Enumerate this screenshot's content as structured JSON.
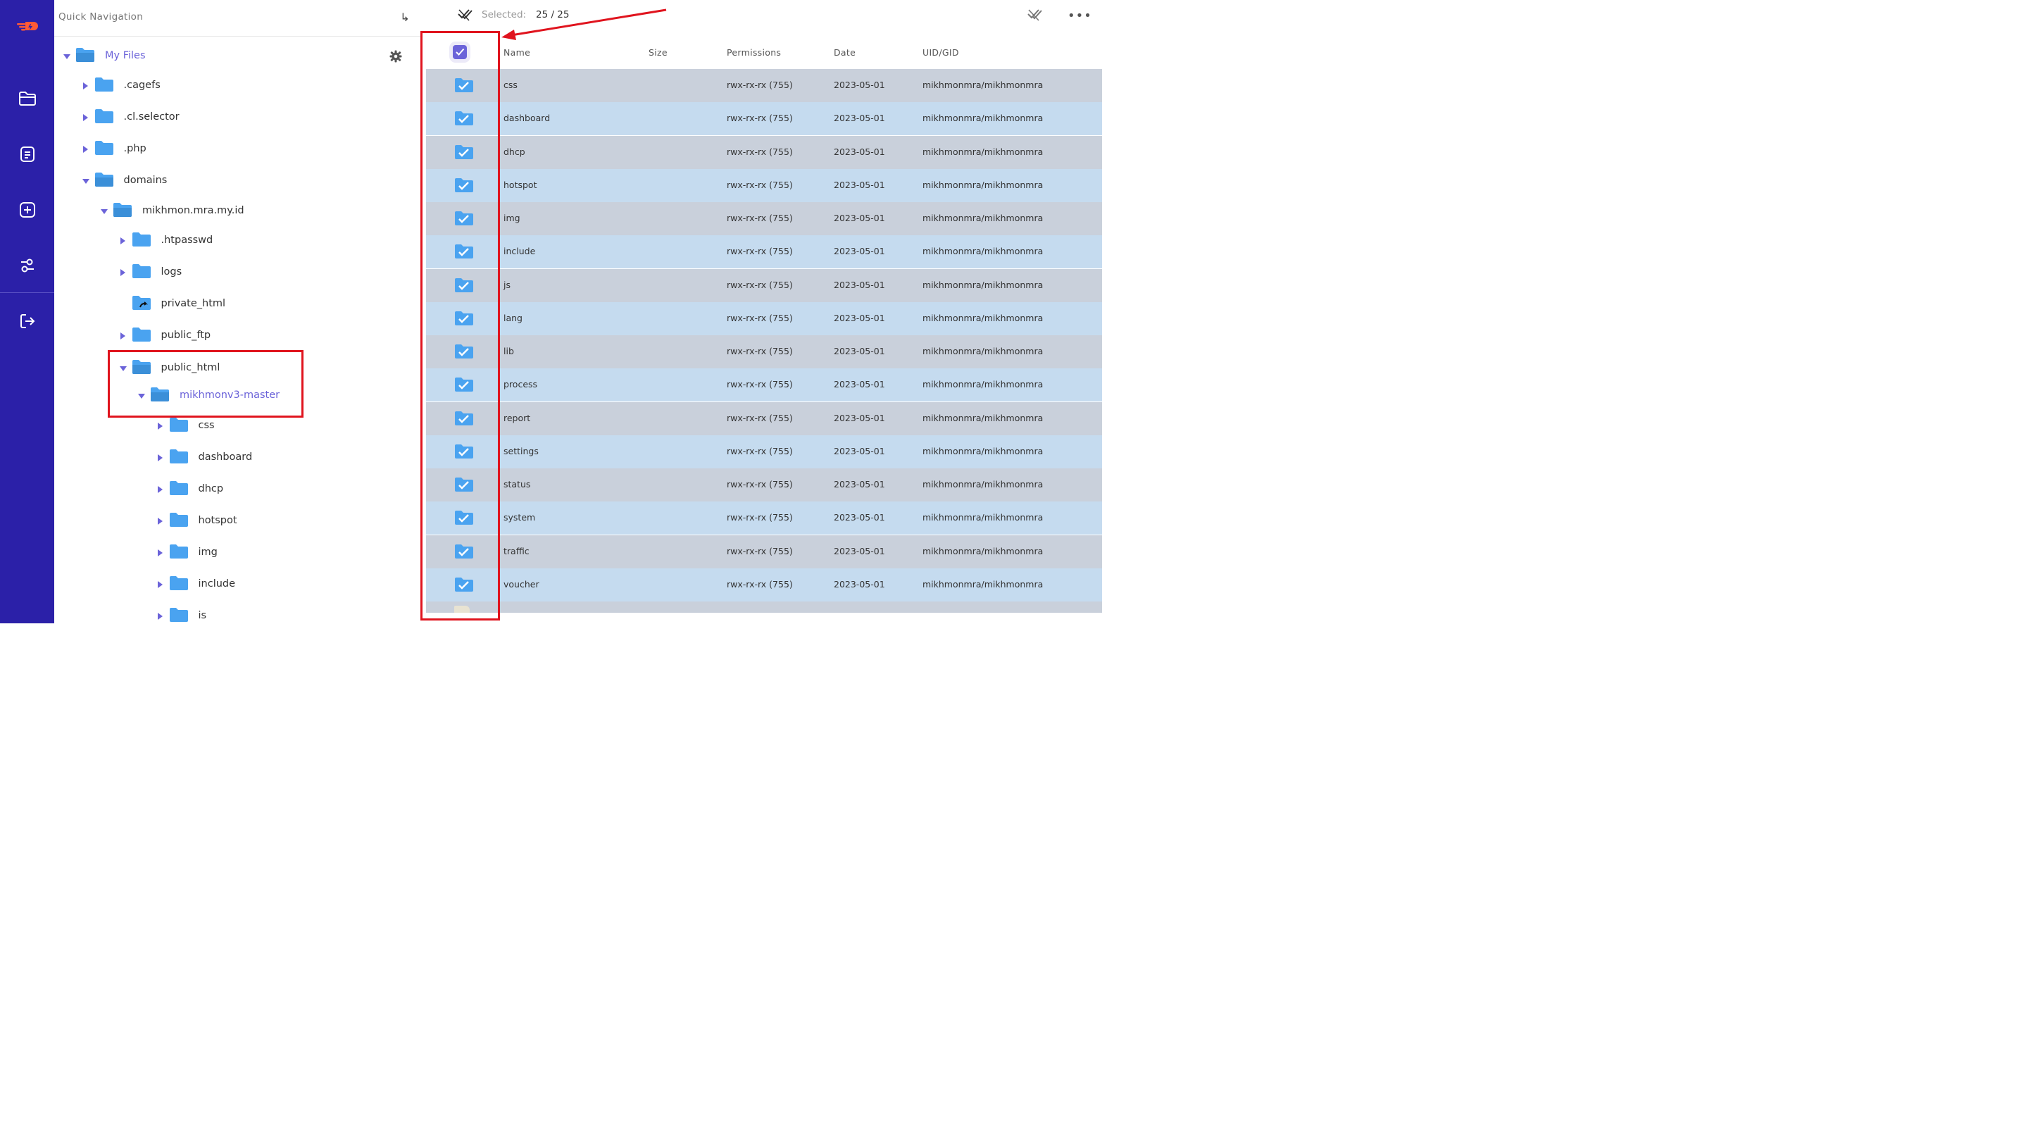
{
  "rail": {
    "items": [
      {
        "name": "app-logo-icon"
      },
      {
        "name": "folder-icon"
      },
      {
        "name": "document-icon"
      },
      {
        "name": "add-icon"
      },
      {
        "name": "sliders-icon"
      },
      {
        "name": "logout-icon"
      }
    ],
    "colors": {
      "background": "#2b20a8",
      "logo": "#ff5a36"
    }
  },
  "tree": {
    "header_label": "Quick Navigation",
    "items": [
      {
        "label": "My Files",
        "level": 0,
        "expanded": true,
        "accent": true,
        "has_children": true
      },
      {
        "label": ".cagefs",
        "level": 1,
        "expanded": false,
        "has_children": true
      },
      {
        "label": ".cl.selector",
        "level": 1,
        "expanded": false,
        "has_children": true
      },
      {
        "label": ".php",
        "level": 1,
        "expanded": false,
        "has_children": true
      },
      {
        "label": "domains",
        "level": 1,
        "expanded": true,
        "has_children": true
      },
      {
        "label": "mikhmon.mra.my.id",
        "level": 2,
        "expanded": true,
        "has_children": true
      },
      {
        "label": ".htpasswd",
        "level": 3,
        "expanded": false,
        "has_children": true
      },
      {
        "label": "logs",
        "level": 3,
        "expanded": false,
        "has_children": true
      },
      {
        "label": "private_html",
        "level": 3,
        "expanded": false,
        "has_children": false,
        "symlink": true
      },
      {
        "label": "public_ftp",
        "level": 3,
        "expanded": false,
        "has_children": true
      },
      {
        "label": "public_html",
        "level": 3,
        "expanded": true,
        "has_children": true
      },
      {
        "label": "mikhmonv3-master",
        "level": 4,
        "expanded": true,
        "accent": true,
        "has_children": true
      },
      {
        "label": "css",
        "level": 5,
        "expanded": false,
        "has_children": true
      },
      {
        "label": "dashboard",
        "level": 5,
        "expanded": false,
        "has_children": true
      },
      {
        "label": "dhcp",
        "level": 5,
        "expanded": false,
        "has_children": true
      },
      {
        "label": "hotspot",
        "level": 5,
        "expanded": false,
        "has_children": true
      },
      {
        "label": "img",
        "level": 5,
        "expanded": false,
        "has_children": true
      },
      {
        "label": "include",
        "level": 5,
        "expanded": false,
        "has_children": true
      },
      {
        "label": "is",
        "level": 5,
        "expanded": false,
        "has_children": true
      }
    ]
  },
  "toolbar": {
    "selected_label": "Selected:",
    "selected_count": "25 / 25"
  },
  "table": {
    "columns": [
      "Name",
      "Size",
      "Permissions",
      "Date",
      "UID/GID"
    ],
    "select_all_checked": true,
    "rows": [
      {
        "name": "css",
        "size": "",
        "permissions": "rwx-rx-rx (755)",
        "date": "2023-05-01",
        "owner": "mikhmonmra/mikhmonmra"
      },
      {
        "name": "dashboard",
        "size": "",
        "permissions": "rwx-rx-rx (755)",
        "date": "2023-05-01",
        "owner": "mikhmonmra/mikhmonmra"
      },
      {
        "name": "dhcp",
        "size": "",
        "permissions": "rwx-rx-rx (755)",
        "date": "2023-05-01",
        "owner": "mikhmonmra/mikhmonmra"
      },
      {
        "name": "hotspot",
        "size": "",
        "permissions": "rwx-rx-rx (755)",
        "date": "2023-05-01",
        "owner": "mikhmonmra/mikhmonmra"
      },
      {
        "name": "img",
        "size": "",
        "permissions": "rwx-rx-rx (755)",
        "date": "2023-05-01",
        "owner": "mikhmonmra/mikhmonmra"
      },
      {
        "name": "include",
        "size": "",
        "permissions": "rwx-rx-rx (755)",
        "date": "2023-05-01",
        "owner": "mikhmonmra/mikhmonmra"
      },
      {
        "name": "js",
        "size": "",
        "permissions": "rwx-rx-rx (755)",
        "date": "2023-05-01",
        "owner": "mikhmonmra/mikhmonmra"
      },
      {
        "name": "lang",
        "size": "",
        "permissions": "rwx-rx-rx (755)",
        "date": "2023-05-01",
        "owner": "mikhmonmra/mikhmonmra"
      },
      {
        "name": "lib",
        "size": "",
        "permissions": "rwx-rx-rx (755)",
        "date": "2023-05-01",
        "owner": "mikhmonmra/mikhmonmra"
      },
      {
        "name": "process",
        "size": "",
        "permissions": "rwx-rx-rx (755)",
        "date": "2023-05-01",
        "owner": "mikhmonmra/mikhmonmra"
      },
      {
        "name": "report",
        "size": "",
        "permissions": "rwx-rx-rx (755)",
        "date": "2023-05-01",
        "owner": "mikhmonmra/mikhmonmra"
      },
      {
        "name": "settings",
        "size": "",
        "permissions": "rwx-rx-rx (755)",
        "date": "2023-05-01",
        "owner": "mikhmonmra/mikhmonmra"
      },
      {
        "name": "status",
        "size": "",
        "permissions": "rwx-rx-rx (755)",
        "date": "2023-05-01",
        "owner": "mikhmonmra/mikhmonmra"
      },
      {
        "name": "system",
        "size": "",
        "permissions": "rwx-rx-rx (755)",
        "date": "2023-05-01",
        "owner": "mikhmonmra/mikhmonmra"
      },
      {
        "name": "traffic",
        "size": "",
        "permissions": "rwx-rx-rx (755)",
        "date": "2023-05-01",
        "owner": "mikhmonmra/mikhmonmra"
      },
      {
        "name": "voucher",
        "size": "",
        "permissions": "rwx-rx-rx (755)",
        "date": "2023-05-01",
        "owner": "mikhmonmra/mikhmonmra"
      }
    ]
  },
  "colors": {
    "accent": "#6b63d9",
    "folder": "#4aa3f0",
    "row_odd": "#c9d0db",
    "row_even": "#c5dbef",
    "annotation": "#e0141e"
  }
}
